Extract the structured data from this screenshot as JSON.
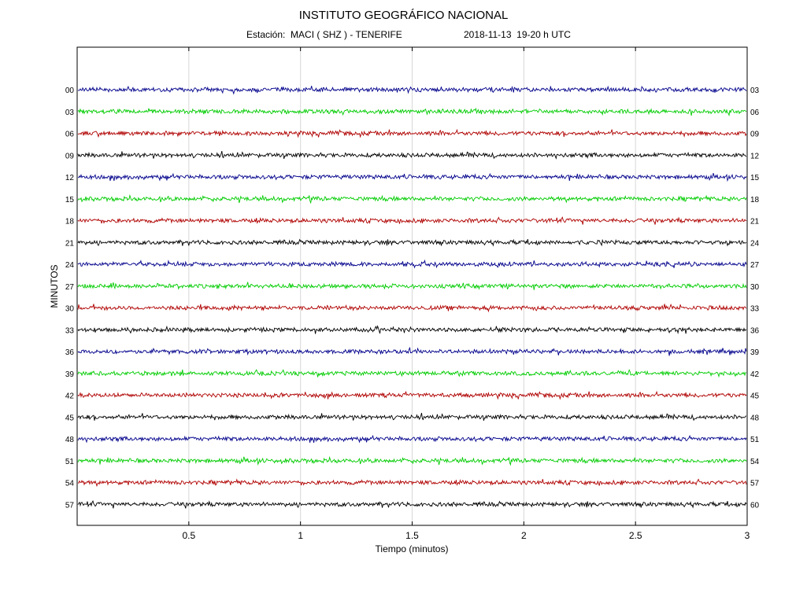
{
  "header": {
    "title": "INSTITUTO GEOGRÁFICO NACIONAL",
    "station_label": "Estación:",
    "station_value": "MACI ( SHZ ) - TENERIFE",
    "datetime": "2018-11-13  19-20 h UTC"
  },
  "chart_data": {
    "type": "line",
    "title": "INSTITUTO GEOGRÁFICO NACIONAL",
    "xlabel": "Tiempo (minutos)",
    "ylabel": "MINUTOS",
    "xlim": [
      0,
      3
    ],
    "x_ticks": [
      0.5,
      1,
      1.5,
      2,
      2.5,
      3
    ],
    "x_tick_labels": [
      "0.5",
      "1",
      "1.5",
      "2",
      "2.5",
      "3"
    ],
    "grid": "vertical dotted at x ticks",
    "left_labels": [
      "00",
      "03",
      "06",
      "09",
      "12",
      "15",
      "18",
      "21",
      "24",
      "27",
      "30",
      "33",
      "36",
      "39",
      "42",
      "45",
      "48",
      "51",
      "54",
      "57"
    ],
    "right_labels": [
      "03",
      "06",
      "09",
      "12",
      "15",
      "18",
      "21",
      "24",
      "27",
      "30",
      "33",
      "36",
      "39",
      "42",
      "45",
      "48",
      "51",
      "54",
      "57",
      "60"
    ],
    "trace_colors": [
      "#00008b",
      "#00cc00",
      "#b00000",
      "#000000"
    ],
    "series": "20 seismogram traces, one per 3-minute window; each trace is low-amplitude background noise with no significant events"
  }
}
